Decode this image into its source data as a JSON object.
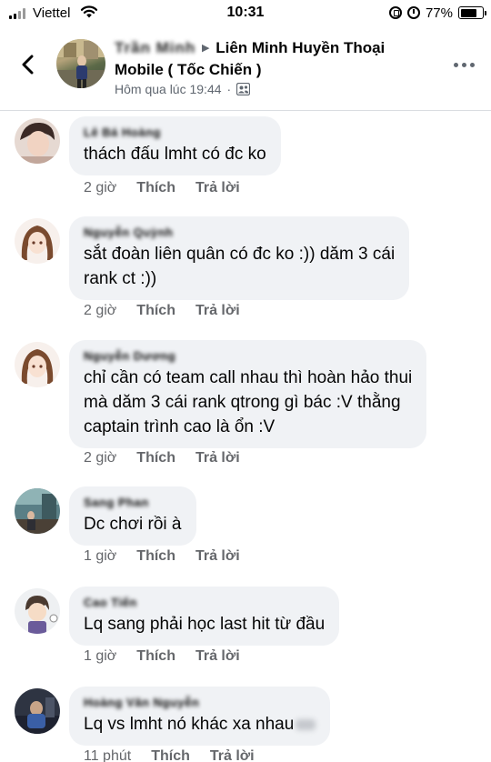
{
  "status_bar": {
    "carrier": "Viettel",
    "time": "10:31",
    "battery_percent": "77%",
    "battery_level": 0.77
  },
  "header": {
    "author": "Trần Minh",
    "group": "Liên Minh Huyền Thoại Mobile ( Tốc Chiến )",
    "timestamp": "Hôm qua lúc 19:44",
    "privacy_icon": "friends-icon",
    "back_icon": "chevron-left-icon",
    "more_icon": "more-horizontal-icon"
  },
  "comments": [
    {
      "author": "Lê Bá Hoàng",
      "text": "thách đấu lmht có đc ko",
      "time": "2 giờ",
      "like_label": "Thích",
      "reply_label": "Trả lời"
    },
    {
      "author": "Nguyễn Quỳnh",
      "text": "sắt đoàn liên quân có đc ko :)) dăm 3 cái\nrank ct :))",
      "time": "2 giờ",
      "like_label": "Thích",
      "reply_label": "Trả lời"
    },
    {
      "author": "Nguyễn Dương",
      "text": "chỉ cần có team call nhau thì hoàn hảo thui\nmà dăm 3 cái rank qtrong gì bác :V thằng\ncaptain trình cao là ổn :V",
      "time": "2 giờ",
      "like_label": "Thích",
      "reply_label": "Trả lời"
    },
    {
      "author": "Sang Phan",
      "text": "Dc chơi rồi à",
      "time": "1 giờ",
      "like_label": "Thích",
      "reply_label": "Trả lời"
    },
    {
      "author": "Cao Tiến",
      "text": "Lq sang phải học last hit từ đầu",
      "time": "1 giờ",
      "like_label": "Thích",
      "reply_label": "Trả lời"
    },
    {
      "author": "Hoàng Văn Nguyễn",
      "text": "Lq vs lmht nó khác xa nhau",
      "time": "11 phút",
      "like_label": "Thích",
      "reply_label": "Trả lời"
    }
  ]
}
